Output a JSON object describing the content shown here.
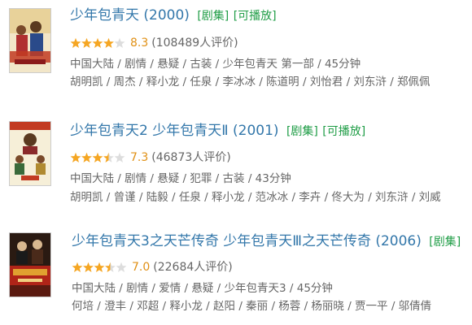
{
  "colors": {
    "link": "#3377aa",
    "tag": "#1f9d46",
    "score": "#e09015",
    "star": "#f5a623",
    "meta": "#666666"
  },
  "results": [
    {
      "title": "少年包青天 (2000)",
      "tags": [
        "[剧集]",
        "[可播放]"
      ],
      "score": "8.3",
      "votes": "(108489人评价)",
      "stars": 4,
      "meta1": "中国大陆 / 剧情 / 悬疑 / 古装 / 少年包青天 第一部 / 45分钟",
      "meta2": "胡明凯 / 周杰 / 释小龙 / 任泉 / 李冰冰 / 陈道明 / 刘怡君 / 刘东浒 / 郑佩佩"
    },
    {
      "title": "少年包青天2 少年包青天Ⅱ (2001)",
      "tags": [
        "[剧集]",
        "[可播放]"
      ],
      "score": "7.3",
      "votes": "(46873人评价)",
      "stars": 3.5,
      "meta1": "中国大陆 / 剧情 / 悬疑 / 犯罪 / 古装 / 43分钟",
      "meta2": "胡明凯 / 曾谨 / 陆毅 / 任泉 / 释小龙 / 范冰冰 / 李卉 / 佟大为 / 刘东浒 / 刘威"
    },
    {
      "title": "少年包青天3之天芒传奇 少年包青天Ⅲ之天芒传奇 (2006)",
      "tags": [
        "[剧集]"
      ],
      "score": "7.0",
      "votes": "(22684人评价)",
      "stars": 3.5,
      "meta1": "中国大陆 / 剧情 / 爱情 / 悬疑 / 少年包青天3 / 45分钟",
      "meta2": "何培 / 澄丰 / 邓超 / 释小龙 / 赵阳 / 秦丽 / 杨蓉 / 杨丽晓 / 贾一平 / 邬倩倩"
    }
  ]
}
